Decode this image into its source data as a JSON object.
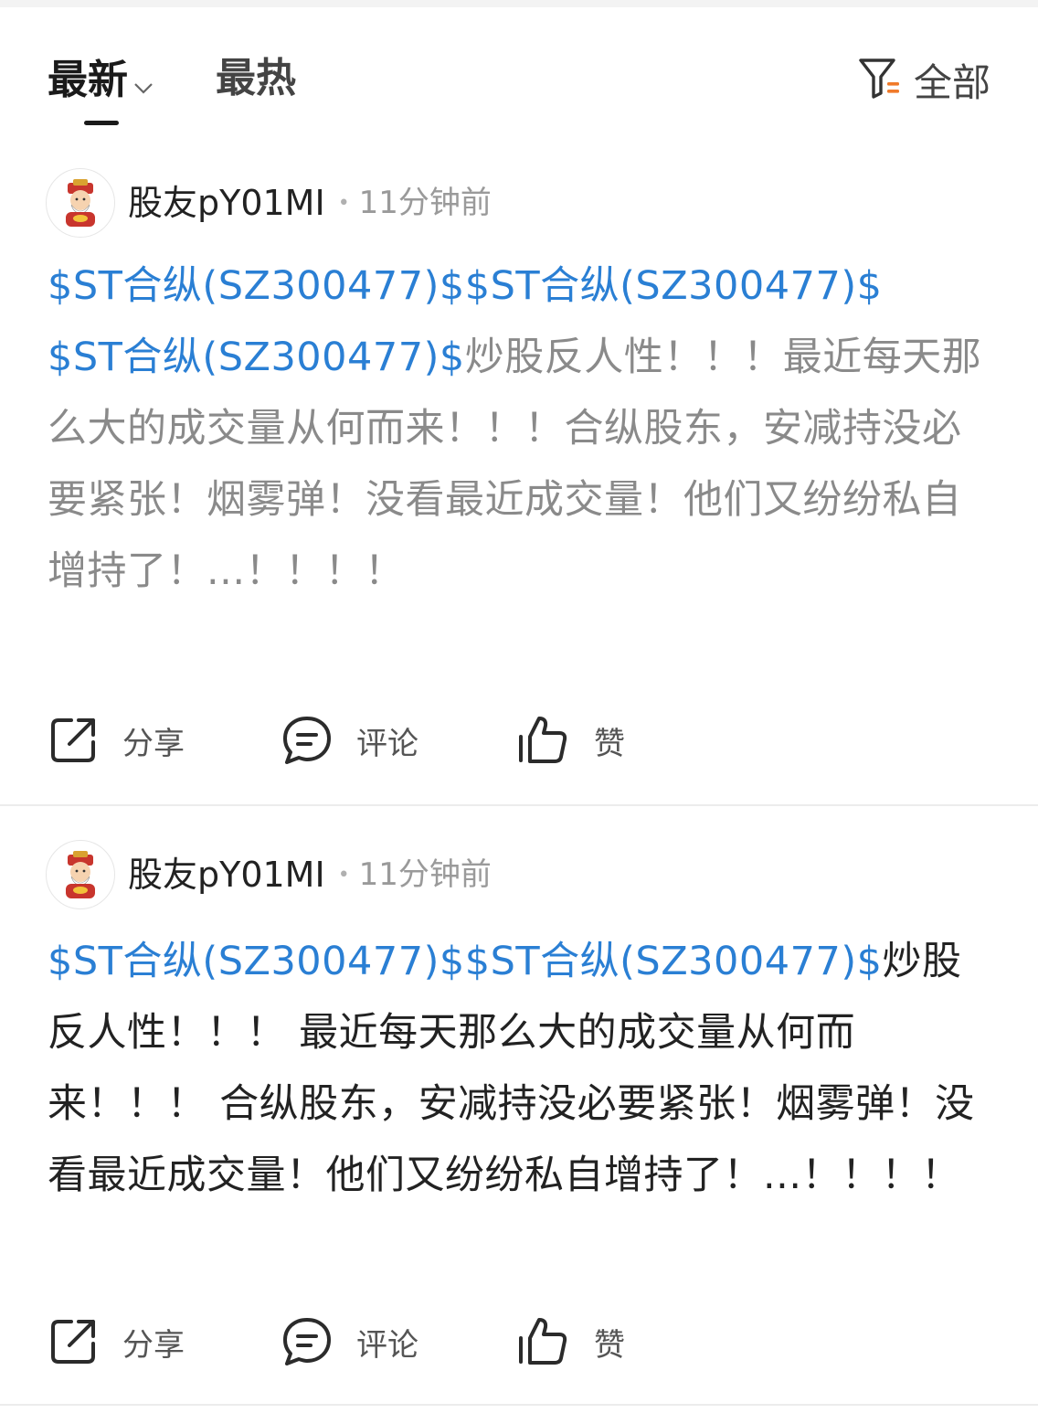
{
  "tabs": {
    "latest": "最新",
    "hot": "最热",
    "filter": "全部"
  },
  "posts": [
    {
      "username": "股友pY01MI",
      "time": "11分钟前",
      "stock_mentions": [
        "$ST合纵(SZ300477)$",
        "$ST合纵(SZ300477)$",
        "$ST合纵(SZ300477)$"
      ],
      "text": "炒股反人性！！！最近每天那么大的成交量从何而来！！！合纵股东，安减持没必要紧张！烟雾弹！没看最近成交量！他们又纷纷私自增持了！...！！！！",
      "actions": {
        "share": "分享",
        "comment": "评论",
        "like": "赞"
      }
    },
    {
      "username": "股友pY01MI",
      "time": "11分钟前",
      "stock_mentions": [
        "$ST合纵(SZ300477)$",
        "$ST合纵(SZ300477)$"
      ],
      "text": "炒股反人性！！！ 最近每天那么大的成交量从何而来！！！ 合纵股东，安减持没必要紧张！烟雾弹！没看最近成交量！他们又纷纷私自增持了！...！！！！",
      "actions": {
        "share": "分享",
        "comment": "评论",
        "like": "赞"
      }
    }
  ],
  "colors": {
    "stock_link": "#2a7fd4",
    "filter_accent": "#f07a2a"
  }
}
